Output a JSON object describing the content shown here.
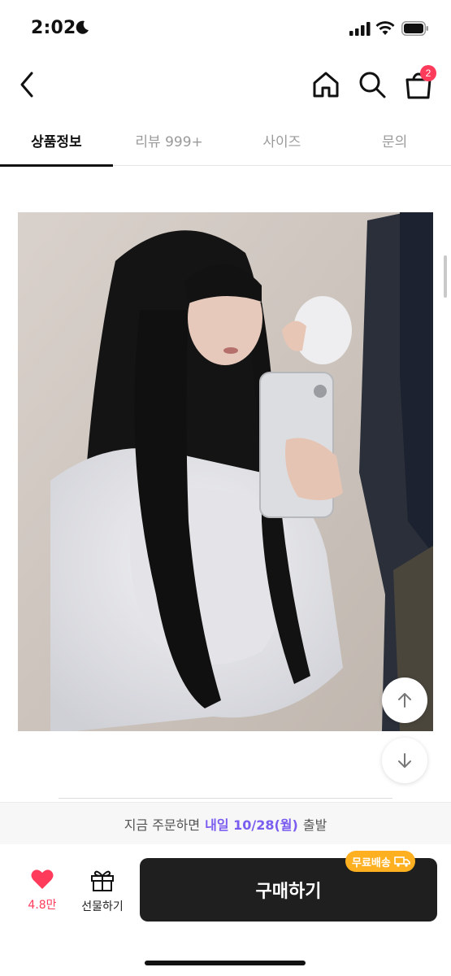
{
  "status_bar": {
    "time": "2:02"
  },
  "nav": {
    "cart_count": "2"
  },
  "tabs": [
    {
      "label": "상품정보",
      "active": true
    },
    {
      "label": "리뷰 999+",
      "active": false
    },
    {
      "label": "사이즈",
      "active": false
    },
    {
      "label": "문의",
      "active": false
    }
  ],
  "delivery": {
    "prefix": "지금 주문하면",
    "highlight": "내일 10/28(월)",
    "suffix": "출발"
  },
  "bottom": {
    "like_count": "4.8만",
    "gift_label": "선물하기",
    "buy_label": "구매하기",
    "free_shipping_badge": "무료배송"
  },
  "colors": {
    "accent": "#7b5cf0",
    "badge": "#ff3b5c",
    "free_shipping": "#ffb020",
    "buy_button": "#1f1f1f"
  }
}
